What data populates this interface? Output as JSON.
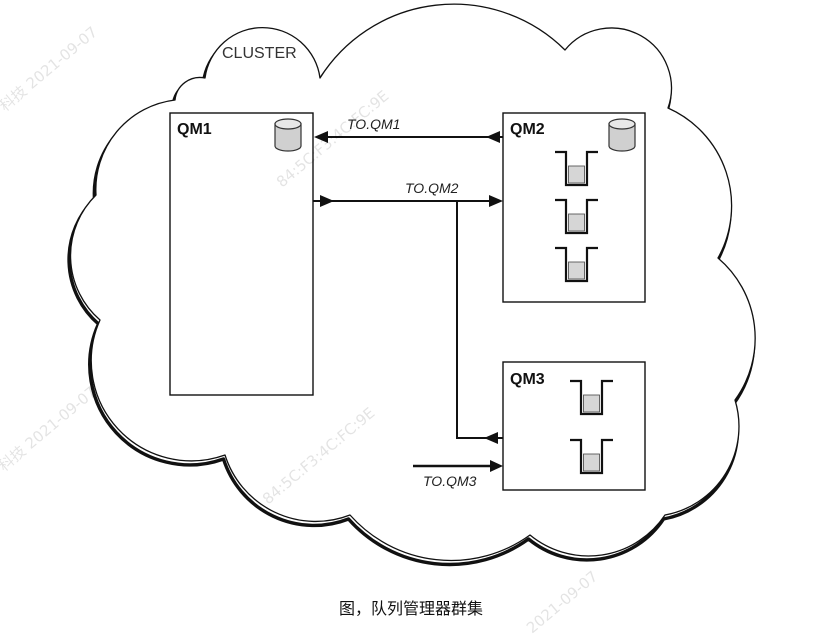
{
  "cluster": {
    "label": "CLUSTER"
  },
  "queue_managers": [
    {
      "name": "QM1",
      "icon": "database-icon",
      "queue_count": 0
    },
    {
      "name": "QM2",
      "icon": "database-icon",
      "queue_count": 3
    },
    {
      "name": "QM3",
      "queue_count": 2
    }
  ],
  "channels": [
    {
      "label": "TO.QM1"
    },
    {
      "label": "TO.QM2"
    },
    {
      "label": "TO.QM3"
    }
  ],
  "caption": "图，队列管理器群集",
  "watermarks": [
    "科技 2021-09-07",
    "84:5C:F3:4C:FC:9E",
    "84:5C:F3:4C:FC:9E",
    "科技 2021-09-07",
    "2021-09-07"
  ],
  "colors": {
    "line": "#111111",
    "queue_fill": "#d6d6d6",
    "cylinder_fill": "#d0d0d0",
    "cylinder_top": "#e8e8e8"
  }
}
